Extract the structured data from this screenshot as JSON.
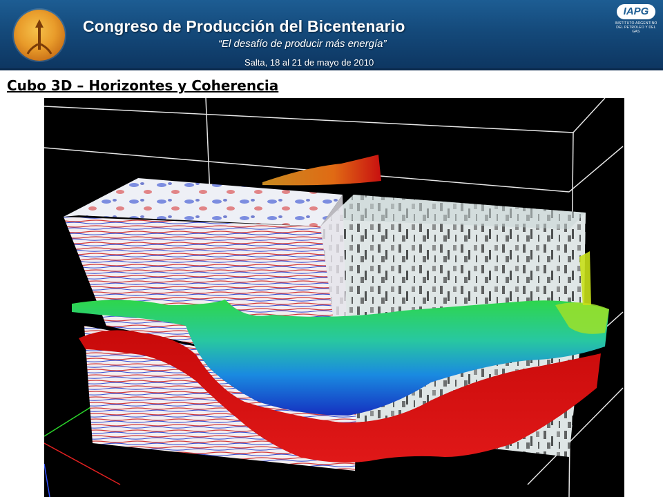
{
  "banner": {
    "title": "Congreso de Producción del Bicentenario",
    "subtitle": "“El desafío de producir más energía”",
    "event": "Salta, 18 al 21 de mayo de 2010",
    "org_badge": "IAPG",
    "org_caption": "INSTITUTO ARGENTINO DEL PETROLEO Y DEL GAS"
  },
  "slide": {
    "title": "Cubo 3D – Horizontes y Coherencia"
  },
  "figure": {
    "description_icon": "seismic-3d-cube-icon"
  },
  "colors": {
    "banner_blue": "#1d5d93",
    "horizon_red": "#d01010",
    "horizon_green": "#38e038",
    "horizon_blue": "#1a3cc8"
  }
}
